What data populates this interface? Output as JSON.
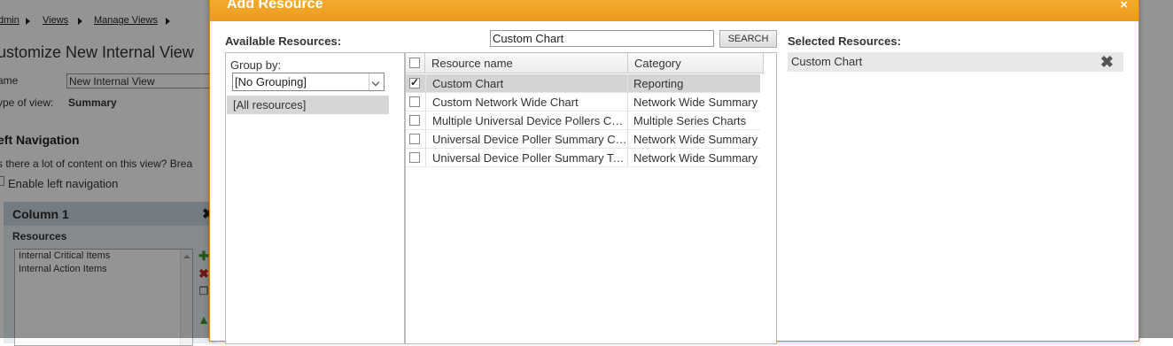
{
  "background": {
    "breadcrumb": [
      "dmin",
      "Views",
      "Manage Views"
    ],
    "page_title": "ustomize New Internal View",
    "name_label": "ame",
    "name_value": "New Internal View",
    "type_label": "ype of view:",
    "type_value": "Summary",
    "left_nav_heading": "eft Navigation",
    "left_nav_text": "s there a lot of content on this view? Brea",
    "enable_left_nav": "Enable left navigation",
    "column_title": "Column 1",
    "resources_label": "Resources",
    "resources_items": [
      "Internal Critical Items",
      "Internal Action Items"
    ]
  },
  "dialog": {
    "title": "Add Resource",
    "close_glyph": "×",
    "available_label": "Available Resources:",
    "search_value": "Custom Chart",
    "search_button": "SEARCH",
    "group_by_label": "Group by:",
    "group_by_value": "[No Grouping]",
    "all_resources": "[All resources]",
    "columns": {
      "name": "Resource name",
      "category": "Category"
    },
    "rows": [
      {
        "name": "Custom Chart",
        "category": "Reporting",
        "checked": true
      },
      {
        "name": "Custom Network Wide Chart",
        "category": "Network Wide Summary",
        "checked": false
      },
      {
        "name": "Multiple Universal Device Pollers Chart",
        "category": "Multiple Series Charts",
        "checked": false
      },
      {
        "name": "Universal Device Poller Summary Chart",
        "category": "Network Wide Summary",
        "checked": false
      },
      {
        "name": "Universal Device Poller Summary Table",
        "category": "Network Wide Summary",
        "checked": false
      }
    ],
    "selected_label": "Selected Resources:",
    "selected_items": [
      "Custom Chart"
    ],
    "remove_glyph": "✖"
  },
  "colors": {
    "header_orange": "#f0a22a",
    "overlay": "rgba(0,0,0,0.42)",
    "selected_row": "#d4d4d4"
  }
}
